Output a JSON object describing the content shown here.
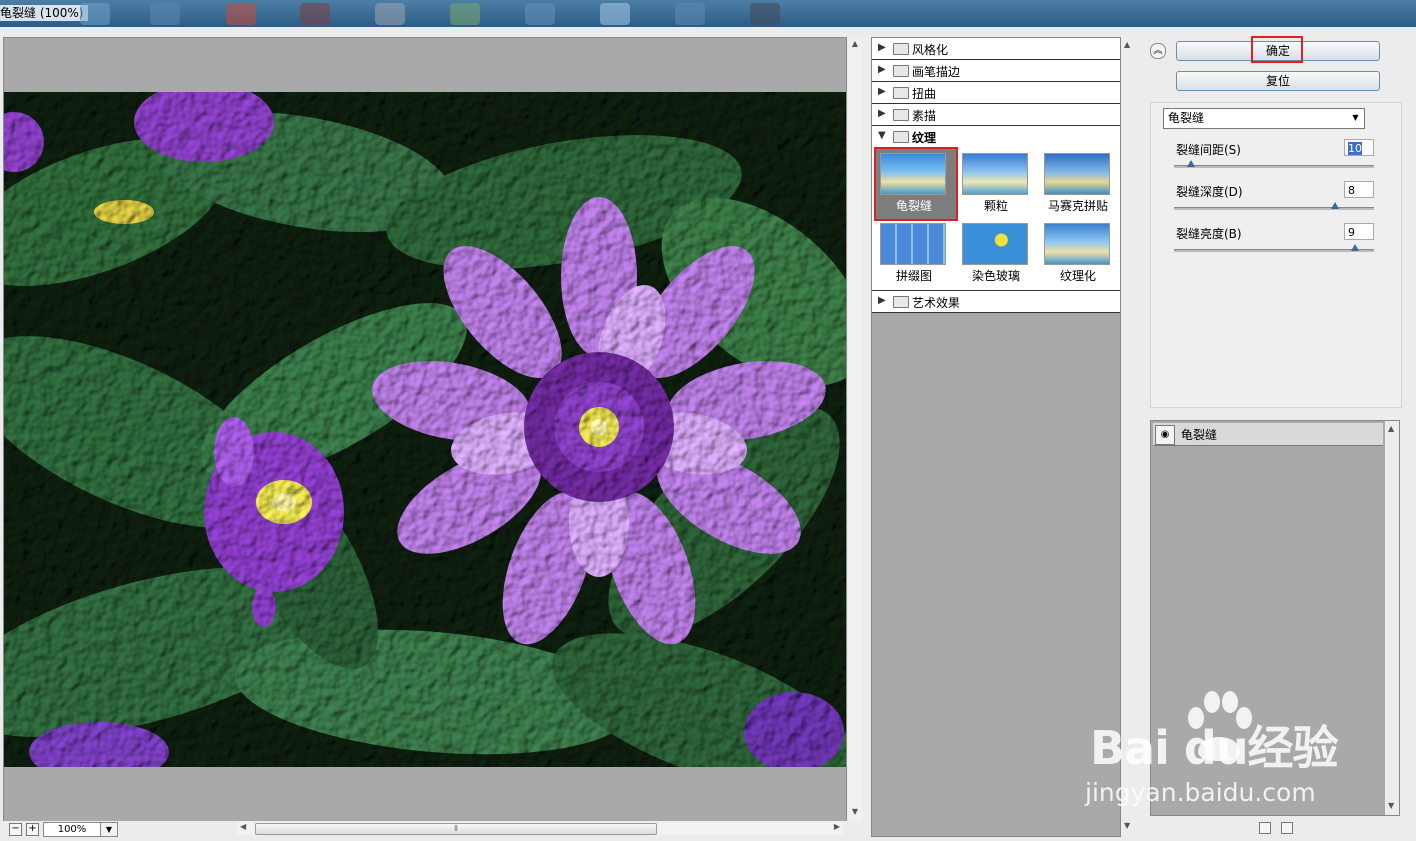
{
  "window": {
    "title": "龟裂缝 (100%)"
  },
  "preview": {
    "zoom": "100%",
    "zoom_out": "−",
    "zoom_in": "+"
  },
  "gallery": {
    "categories": [
      {
        "label": "风格化",
        "expanded": false
      },
      {
        "label": "画笔描边",
        "expanded": false
      },
      {
        "label": "扭曲",
        "expanded": false
      },
      {
        "label": "素描",
        "expanded": false
      },
      {
        "label": "纹理",
        "expanded": true
      },
      {
        "label": "艺术效果",
        "expanded": false
      }
    ],
    "texture_filters": [
      {
        "label": "龟裂缝",
        "selected": true
      },
      {
        "label": "颗粒",
        "selected": false
      },
      {
        "label": "马赛克拼贴",
        "selected": false
      },
      {
        "label": "拼缀图",
        "selected": false
      },
      {
        "label": "染色玻璃",
        "selected": false
      },
      {
        "label": "纹理化",
        "selected": false
      }
    ]
  },
  "buttons": {
    "ok": "确定",
    "reset": "复位"
  },
  "settings": {
    "filter": "龟裂缝",
    "params": [
      {
        "label": "裂缝间距(S)",
        "value": "10",
        "min": 2,
        "max": 100
      },
      {
        "label": "裂缝深度(D)",
        "value": "8",
        "min": 0,
        "max": 10
      },
      {
        "label": "裂缝亮度(B)",
        "value": "9",
        "min": 0,
        "max": 10
      }
    ]
  },
  "layers": {
    "items": [
      {
        "name": "龟裂缝",
        "visible": true
      }
    ]
  },
  "watermark": {
    "brand": "Bai  du经验",
    "url": "jingyan.baidu.com"
  },
  "colors": {
    "highlight": "#e02020",
    "panel": "#a9a9a9",
    "leaf": "#2f6a3a",
    "petal": "#b77be0"
  }
}
